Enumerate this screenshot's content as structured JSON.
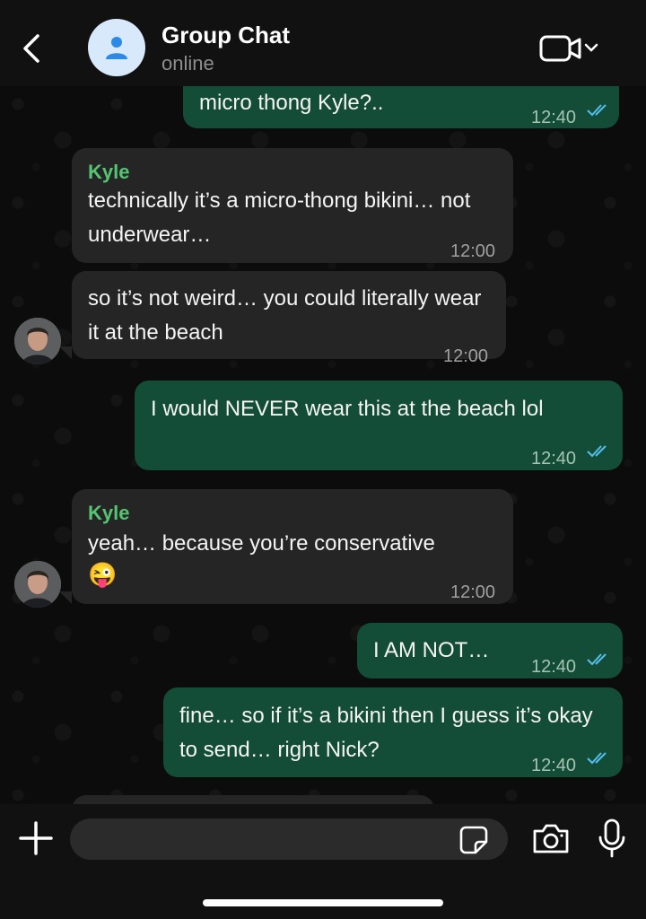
{
  "header": {
    "title": "Group Chat",
    "status": "online"
  },
  "messages": [
    {
      "type": "out",
      "text": "micro thong Kyle?..",
      "time": "12:40"
    },
    {
      "type": "in",
      "sender": "Kyle",
      "text": "technically it’s a micro-thong bikini… not underwear…",
      "time": "12:00"
    },
    {
      "type": "in",
      "text": "so it’s not weird… you could literally wear it at the beach",
      "time": "12:00"
    },
    {
      "type": "out",
      "text": "I would NEVER wear this at the beach lol",
      "time": "12:40"
    },
    {
      "type": "in",
      "sender": "Kyle",
      "text": "yeah… because you’re conservative",
      "emoji": "😜",
      "time": "12:00"
    },
    {
      "type": "out",
      "text": "I AM NOT…",
      "time": "12:40"
    },
    {
      "type": "out",
      "text": "fine… so if it’s a bikini then I guess it’s okay to send… right Nick?",
      "time": "12:40"
    }
  ],
  "input": {
    "placeholder": ""
  },
  "colors": {
    "outgoing": "#144d37",
    "incoming": "#252525",
    "sender": "#55c572",
    "ticks": "#53bdeb"
  },
  "icons": [
    "back-arrow-icon",
    "user-icon",
    "video-call-icon",
    "chevron-down-icon",
    "plus-icon",
    "sticker-icon",
    "camera-icon",
    "microphone-icon",
    "double-check-icon"
  ]
}
